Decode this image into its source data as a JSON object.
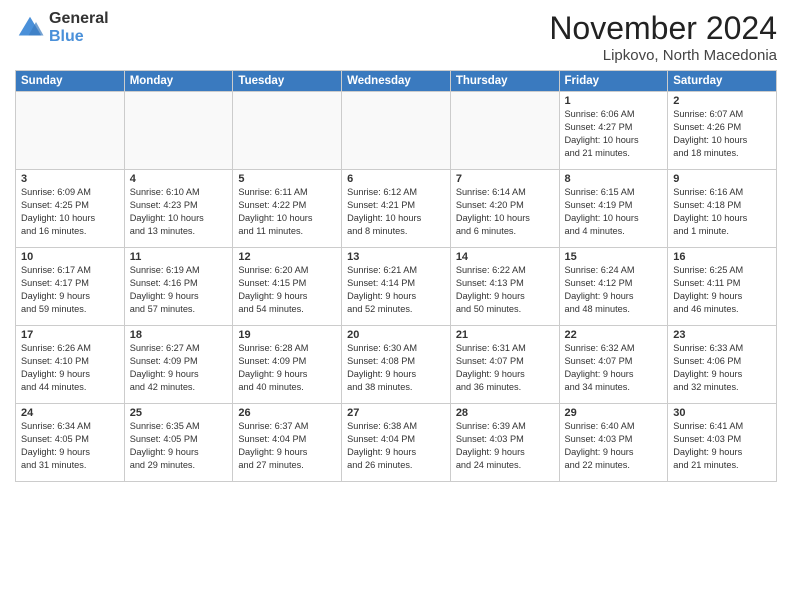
{
  "logo": {
    "general": "General",
    "blue": "Blue"
  },
  "title": "November 2024",
  "subtitle": "Lipkovo, North Macedonia",
  "days_header": [
    "Sunday",
    "Monday",
    "Tuesday",
    "Wednesday",
    "Thursday",
    "Friday",
    "Saturday"
  ],
  "weeks": [
    [
      {
        "day": "",
        "info": ""
      },
      {
        "day": "",
        "info": ""
      },
      {
        "day": "",
        "info": ""
      },
      {
        "day": "",
        "info": ""
      },
      {
        "day": "",
        "info": ""
      },
      {
        "day": "1",
        "info": "Sunrise: 6:06 AM\nSunset: 4:27 PM\nDaylight: 10 hours\nand 21 minutes."
      },
      {
        "day": "2",
        "info": "Sunrise: 6:07 AM\nSunset: 4:26 PM\nDaylight: 10 hours\nand 18 minutes."
      }
    ],
    [
      {
        "day": "3",
        "info": "Sunrise: 6:09 AM\nSunset: 4:25 PM\nDaylight: 10 hours\nand 16 minutes."
      },
      {
        "day": "4",
        "info": "Sunrise: 6:10 AM\nSunset: 4:23 PM\nDaylight: 10 hours\nand 13 minutes."
      },
      {
        "day": "5",
        "info": "Sunrise: 6:11 AM\nSunset: 4:22 PM\nDaylight: 10 hours\nand 11 minutes."
      },
      {
        "day": "6",
        "info": "Sunrise: 6:12 AM\nSunset: 4:21 PM\nDaylight: 10 hours\nand 8 minutes."
      },
      {
        "day": "7",
        "info": "Sunrise: 6:14 AM\nSunset: 4:20 PM\nDaylight: 10 hours\nand 6 minutes."
      },
      {
        "day": "8",
        "info": "Sunrise: 6:15 AM\nSunset: 4:19 PM\nDaylight: 10 hours\nand 4 minutes."
      },
      {
        "day": "9",
        "info": "Sunrise: 6:16 AM\nSunset: 4:18 PM\nDaylight: 10 hours\nand 1 minute."
      }
    ],
    [
      {
        "day": "10",
        "info": "Sunrise: 6:17 AM\nSunset: 4:17 PM\nDaylight: 9 hours\nand 59 minutes."
      },
      {
        "day": "11",
        "info": "Sunrise: 6:19 AM\nSunset: 4:16 PM\nDaylight: 9 hours\nand 57 minutes."
      },
      {
        "day": "12",
        "info": "Sunrise: 6:20 AM\nSunset: 4:15 PM\nDaylight: 9 hours\nand 54 minutes."
      },
      {
        "day": "13",
        "info": "Sunrise: 6:21 AM\nSunset: 4:14 PM\nDaylight: 9 hours\nand 52 minutes."
      },
      {
        "day": "14",
        "info": "Sunrise: 6:22 AM\nSunset: 4:13 PM\nDaylight: 9 hours\nand 50 minutes."
      },
      {
        "day": "15",
        "info": "Sunrise: 6:24 AM\nSunset: 4:12 PM\nDaylight: 9 hours\nand 48 minutes."
      },
      {
        "day": "16",
        "info": "Sunrise: 6:25 AM\nSunset: 4:11 PM\nDaylight: 9 hours\nand 46 minutes."
      }
    ],
    [
      {
        "day": "17",
        "info": "Sunrise: 6:26 AM\nSunset: 4:10 PM\nDaylight: 9 hours\nand 44 minutes."
      },
      {
        "day": "18",
        "info": "Sunrise: 6:27 AM\nSunset: 4:09 PM\nDaylight: 9 hours\nand 42 minutes."
      },
      {
        "day": "19",
        "info": "Sunrise: 6:28 AM\nSunset: 4:09 PM\nDaylight: 9 hours\nand 40 minutes."
      },
      {
        "day": "20",
        "info": "Sunrise: 6:30 AM\nSunset: 4:08 PM\nDaylight: 9 hours\nand 38 minutes."
      },
      {
        "day": "21",
        "info": "Sunrise: 6:31 AM\nSunset: 4:07 PM\nDaylight: 9 hours\nand 36 minutes."
      },
      {
        "day": "22",
        "info": "Sunrise: 6:32 AM\nSunset: 4:07 PM\nDaylight: 9 hours\nand 34 minutes."
      },
      {
        "day": "23",
        "info": "Sunrise: 6:33 AM\nSunset: 4:06 PM\nDaylight: 9 hours\nand 32 minutes."
      }
    ],
    [
      {
        "day": "24",
        "info": "Sunrise: 6:34 AM\nSunset: 4:05 PM\nDaylight: 9 hours\nand 31 minutes."
      },
      {
        "day": "25",
        "info": "Sunrise: 6:35 AM\nSunset: 4:05 PM\nDaylight: 9 hours\nand 29 minutes."
      },
      {
        "day": "26",
        "info": "Sunrise: 6:37 AM\nSunset: 4:04 PM\nDaylight: 9 hours\nand 27 minutes."
      },
      {
        "day": "27",
        "info": "Sunrise: 6:38 AM\nSunset: 4:04 PM\nDaylight: 9 hours\nand 26 minutes."
      },
      {
        "day": "28",
        "info": "Sunrise: 6:39 AM\nSunset: 4:03 PM\nDaylight: 9 hours\nand 24 minutes."
      },
      {
        "day": "29",
        "info": "Sunrise: 6:40 AM\nSunset: 4:03 PM\nDaylight: 9 hours\nand 22 minutes."
      },
      {
        "day": "30",
        "info": "Sunrise: 6:41 AM\nSunset: 4:03 PM\nDaylight: 9 hours\nand 21 minutes."
      }
    ]
  ]
}
